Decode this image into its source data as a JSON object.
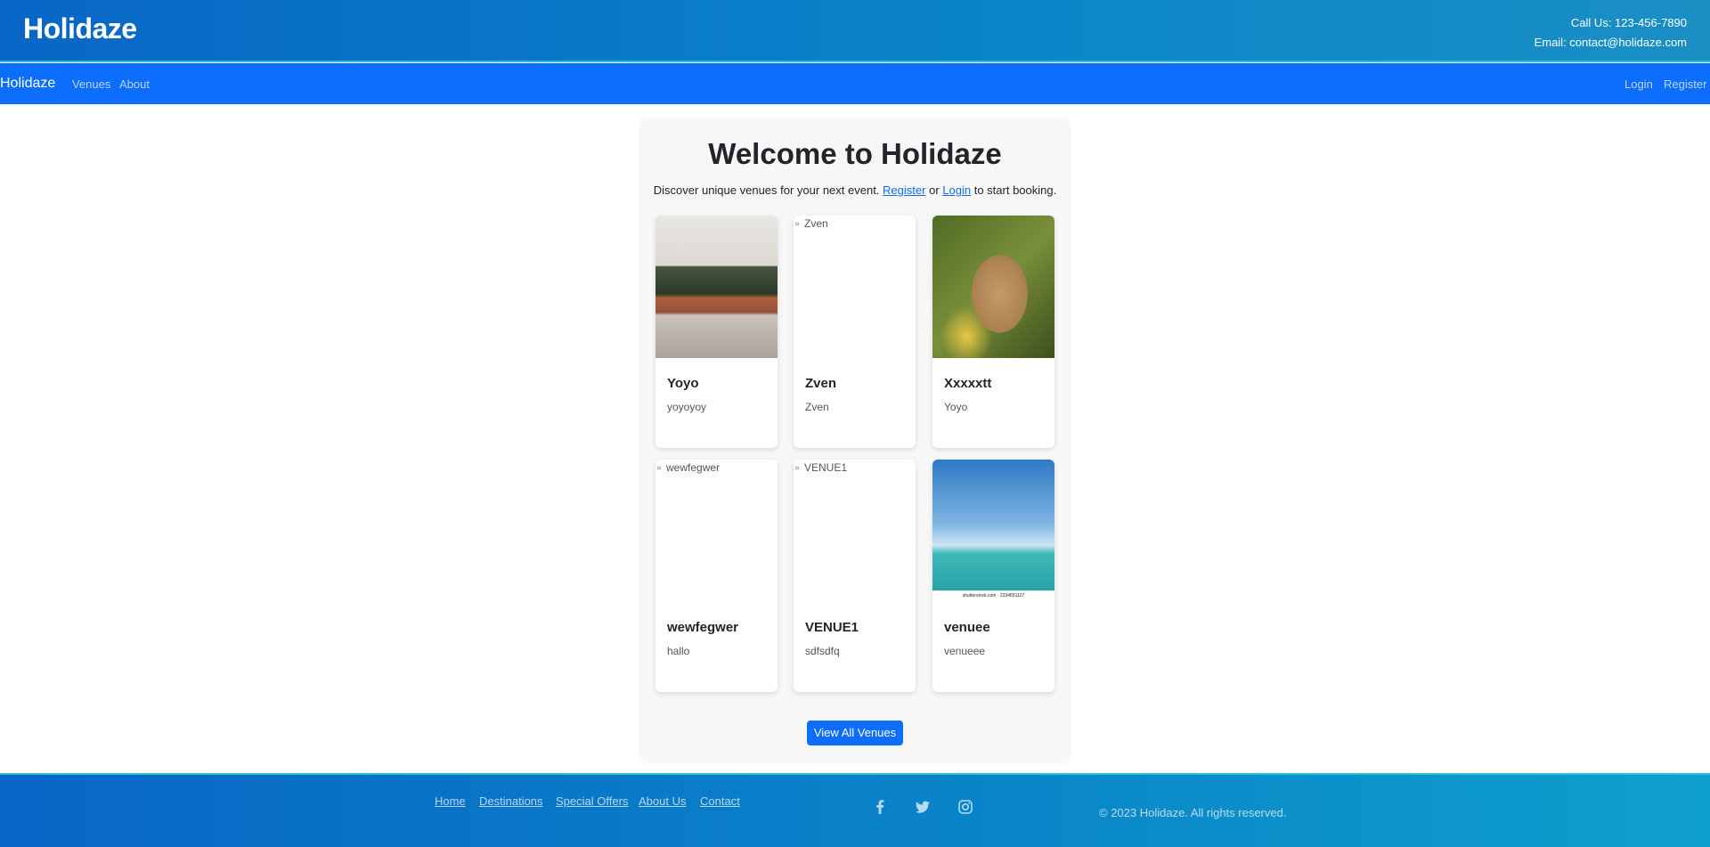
{
  "header": {
    "brand": "Holidaze",
    "phone": "Call Us: 123-456-7890",
    "email": "Email: contact@holidaze.com"
  },
  "nav": {
    "brand": "Holidaze",
    "links": [
      "Venues",
      "About"
    ],
    "login": "Login",
    "register": "Register"
  },
  "hero": {
    "title": "Welcome to Holidaze",
    "subtitle_before": "Discover unique venues for your next event.",
    "register_link": "Register",
    "or": "or",
    "login_link": "Login",
    "subtitle_after": "to start booking."
  },
  "venues": [
    {
      "name": "Yoyo",
      "description": "yoyoyoy",
      "image": "room-photo"
    },
    {
      "name": "Zven",
      "description": "Zven",
      "image_alt": "Zven"
    },
    {
      "name": "Xxxxxtt",
      "description": "Yoyo",
      "image": "monkey-photo"
    },
    {
      "name": "wewfegwer",
      "description": "hallo",
      "image_alt": "wewfegwer"
    },
    {
      "name": "VENUE1",
      "description": "sdfsdfq",
      "image_alt": "VENUE1"
    },
    {
      "name": "venuee",
      "description": "venueee",
      "image": "beach-photo",
      "image_credit": "shutterstock.com · 2234651127"
    }
  ],
  "view_all": "View All Venues",
  "footer": {
    "links": [
      "Home",
      "Destinations",
      "Special Offers",
      "About Us",
      "Contact"
    ],
    "social_icons": [
      "facebook-icon",
      "twitter-icon",
      "instagram-icon"
    ],
    "copyright": "© 2023 Holidaze. All rights reserved."
  },
  "colors": {
    "primary": "#0d6efd",
    "header_gradient_start": "#0866c6",
    "accent_border": "#2bc0d6"
  }
}
